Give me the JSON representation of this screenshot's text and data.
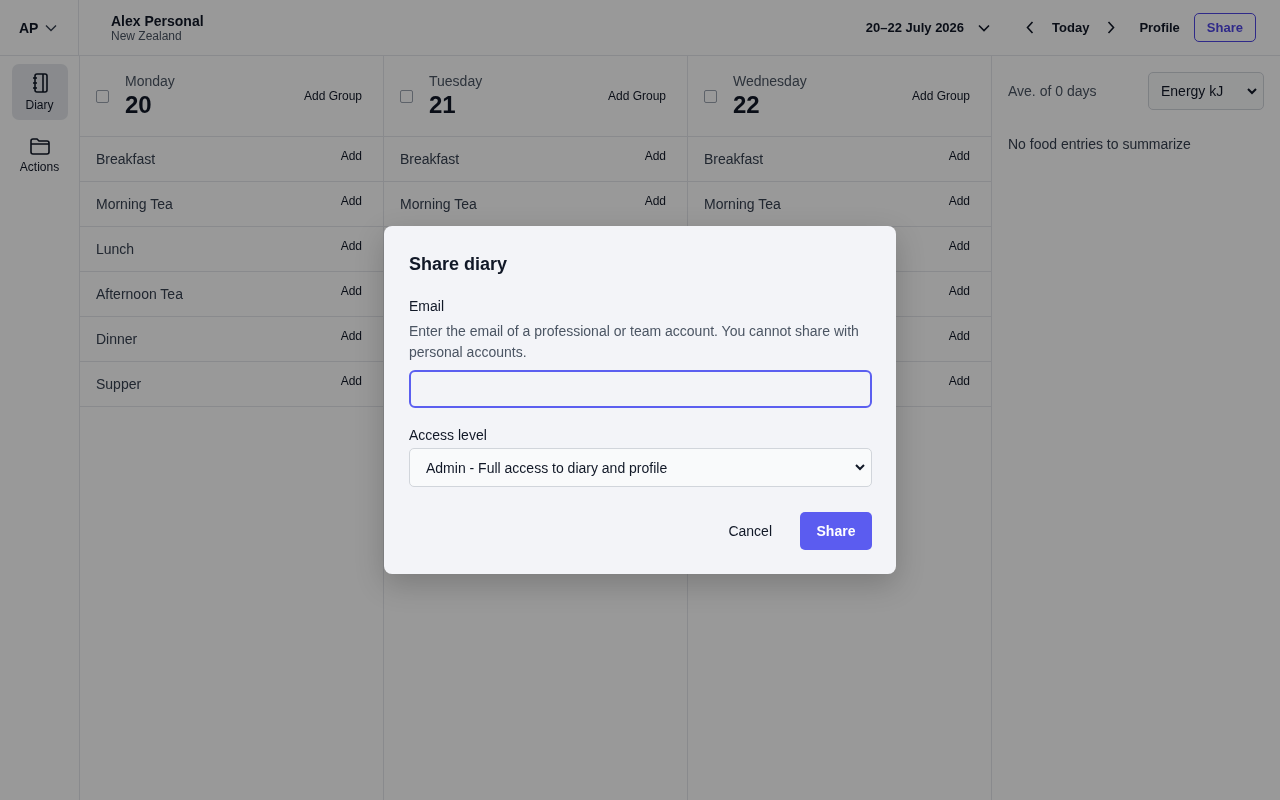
{
  "account": {
    "initials": "AP",
    "name": "Alex Personal",
    "region": "New Zealand"
  },
  "header": {
    "date_range": "20–22 July 2026",
    "today": "Today",
    "profile": "Profile",
    "share": "Share"
  },
  "sidebar": {
    "items": [
      {
        "label": "Diary",
        "kind": "diary",
        "selected": true
      },
      {
        "label": "Actions",
        "kind": "actions",
        "selected": false
      }
    ]
  },
  "days": [
    {
      "weekday": "Monday",
      "date": "20",
      "checked": false,
      "add_group": "Add Group",
      "meals": [
        {
          "name": "Breakfast",
          "add": "Add"
        },
        {
          "name": "Morning Tea",
          "add": "Add"
        },
        {
          "name": "Lunch",
          "add": "Add"
        },
        {
          "name": "Afternoon Tea",
          "add": "Add"
        },
        {
          "name": "Dinner",
          "add": "Add"
        },
        {
          "name": "Supper",
          "add": "Add"
        }
      ]
    },
    {
      "weekday": "Tuesday",
      "date": "21",
      "checked": false,
      "add_group": "Add Group",
      "meals": [
        {
          "name": "Breakfast",
          "add": "Add"
        },
        {
          "name": "Morning Tea",
          "add": "Add"
        }
      ]
    },
    {
      "weekday": "Wednesday",
      "date": "22",
      "checked": false,
      "add_group": "Add Group",
      "meals": [
        {
          "name": "Breakfast",
          "add": "Add"
        },
        {
          "name": "Morning Tea",
          "add": "Add"
        },
        {
          "add": "Add"
        },
        {
          "add": "Add"
        },
        {
          "add": "Add"
        },
        {
          "add": "Add"
        }
      ]
    }
  ],
  "summary": {
    "average": "Ave. of 0 days",
    "nutrient": "Energy kJ",
    "empty": "No food entries to summarize"
  },
  "dialog": {
    "title": "Share diary",
    "email_label": "Email",
    "email_help": "Enter the email of a professional or team account. You cannot share with personal accounts.",
    "access_label": "Access level",
    "access_value": "Admin - Full access to diary and profile",
    "cancel": "Cancel",
    "share": "Share"
  }
}
